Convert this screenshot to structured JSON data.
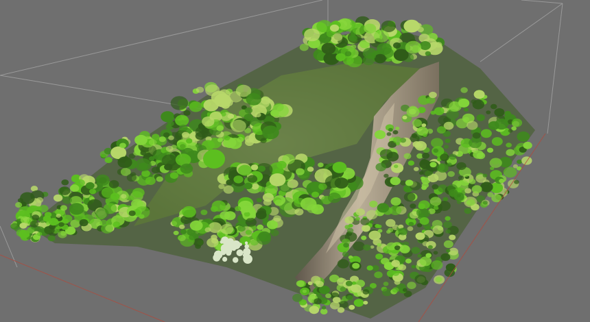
{
  "viewport": {
    "background_color": "#6f6f6f"
  },
  "bounding_box": {
    "edge_color": "#9a9a9a",
    "near_edge_color": "#b04a3c"
  },
  "point_cloud": {
    "vegetation_colors": [
      "#5cbf1f",
      "#84d63a",
      "#3e8a1c",
      "#b8d86a",
      "#2f5c18"
    ],
    "ground_color": "#8ea266",
    "cliff_colors": [
      "#8d8472",
      "#b9ad97",
      "#5f574b"
    ],
    "highlight_color": "#d9e6c8"
  }
}
